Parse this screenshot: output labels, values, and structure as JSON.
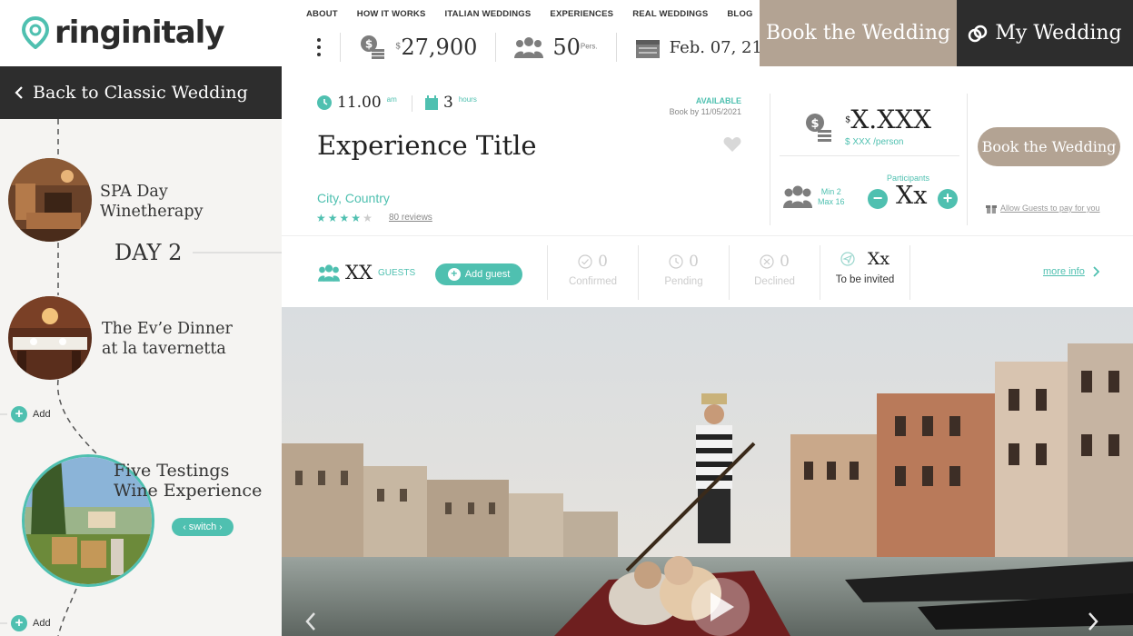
{
  "brand": {
    "name": "ringinitaly"
  },
  "nav": {
    "items": [
      "ABOUT",
      "HOW IT WORKS",
      "ITALIAN WEDDINGS",
      "EXPERIENCES",
      "REAL WEDDINGS",
      "BLOG"
    ]
  },
  "stats": {
    "budget_currency": "$",
    "budget": "27,900",
    "people": "50",
    "people_unit": "Pers.",
    "date": "Feb. 07, 21"
  },
  "header_buttons": {
    "book": "Book the Wedding",
    "my_wedding": "My Wedding"
  },
  "sidebar": {
    "back": "Back to Classic Wedding",
    "day_label": "DAY 2",
    "items": [
      {
        "line1": "SPA Day",
        "line2": "Winetherapy"
      },
      {
        "line1": "The Ev’e Dinner",
        "line2": "at la tavernetta"
      },
      {
        "line1": "Five Testings",
        "line2": "Wine Experience"
      }
    ],
    "add_label": "Add",
    "switch_label": "switch"
  },
  "experience": {
    "time": "11.00",
    "time_unit": "am",
    "duration": "3",
    "duration_unit": "hours",
    "availability": "AVAILABLE",
    "book_by": "Book by 11/05/2021",
    "title": "Experience Title",
    "location": "City, Country",
    "rating": 4,
    "reviews": "80 reviews",
    "price_currency": "$",
    "price": "X.XXX",
    "per_person": "$ XXX /person",
    "participants_label": "Participants",
    "min": "Min  2",
    "max": "Max 16",
    "participants_value": "Xx",
    "book_button": "Book the Wedding",
    "allow_guests": "Allow Guests to pay for you"
  },
  "guests": {
    "count": "XX",
    "label": "GUESTS",
    "add_guest": "Add guest",
    "confirmed": {
      "num": "0",
      "label": "Confirmed"
    },
    "pending": {
      "num": "0",
      "label": "Pending"
    },
    "declined": {
      "num": "0",
      "label": "Declined"
    },
    "to_invite": {
      "num": "Xx",
      "label": "To be invited"
    },
    "more_info": "more info"
  },
  "colors": {
    "accent": "#4fc0b0",
    "taupe": "#b3a393",
    "dark": "#2d2d2d"
  }
}
